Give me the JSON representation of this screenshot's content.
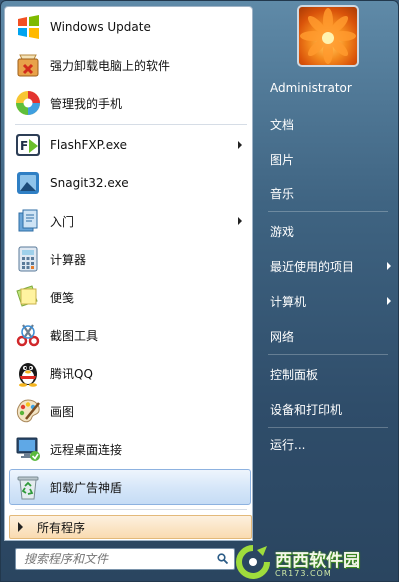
{
  "left_programs": [
    {
      "label": "Windows Update",
      "icon": "windows-update-icon",
      "has_submenu": false
    },
    {
      "label": "强力卸载电脑上的软件",
      "icon": "uninstall-box-icon",
      "has_submenu": false
    },
    {
      "label": "管理我的手机",
      "icon": "phone-manager-icon",
      "has_submenu": false
    },
    {
      "label": "FlashFXP.exe",
      "icon": "flashfxp-icon",
      "has_submenu": true
    },
    {
      "label": "Snagit32.exe",
      "icon": "snagit-icon",
      "has_submenu": false
    },
    {
      "label": "入门",
      "icon": "getting-started-icon",
      "has_submenu": true
    },
    {
      "label": "计算器",
      "icon": "calculator-icon",
      "has_submenu": false
    },
    {
      "label": "便笺",
      "icon": "sticky-notes-icon",
      "has_submenu": false
    },
    {
      "label": "截图工具",
      "icon": "snipping-tool-icon",
      "has_submenu": false
    },
    {
      "label": "腾讯QQ",
      "icon": "qq-penguin-icon",
      "has_submenu": false
    },
    {
      "label": "画图",
      "icon": "paint-palette-icon",
      "has_submenu": false
    },
    {
      "label": "远程桌面连接",
      "icon": "remote-desktop-icon",
      "has_submenu": false
    },
    {
      "label": "卸载广告神盾",
      "icon": "recycle-uninstall-icon",
      "has_submenu": false,
      "highlighted": true
    }
  ],
  "all_programs_label": "所有程序",
  "search": {
    "placeholder": "搜索程序和文件",
    "icon": "search-icon"
  },
  "right_items": [
    {
      "label": "Administrator",
      "has_submenu": false
    },
    {
      "label": "文档",
      "has_submenu": false
    },
    {
      "label": "图片",
      "has_submenu": false
    },
    {
      "label": "音乐",
      "has_submenu": false
    },
    {
      "label": "游戏",
      "has_submenu": false
    },
    {
      "label": "最近使用的项目",
      "has_submenu": true
    },
    {
      "label": "计算机",
      "has_submenu": true
    },
    {
      "label": "网络",
      "has_submenu": false
    },
    {
      "label": "控制面板",
      "has_submenu": false
    },
    {
      "label": "设备和打印机",
      "has_submenu": false
    },
    {
      "label": "运行...",
      "has_submenu": false
    }
  ],
  "user_avatar_icon": "flower-avatar-icon",
  "watermark": {
    "main": "西西软件园",
    "sub": "CR173.COM"
  },
  "colors": {
    "highlight": "#c6dcf5",
    "all_programs": "#f9dbb0",
    "right_panel": "#3f6482"
  }
}
